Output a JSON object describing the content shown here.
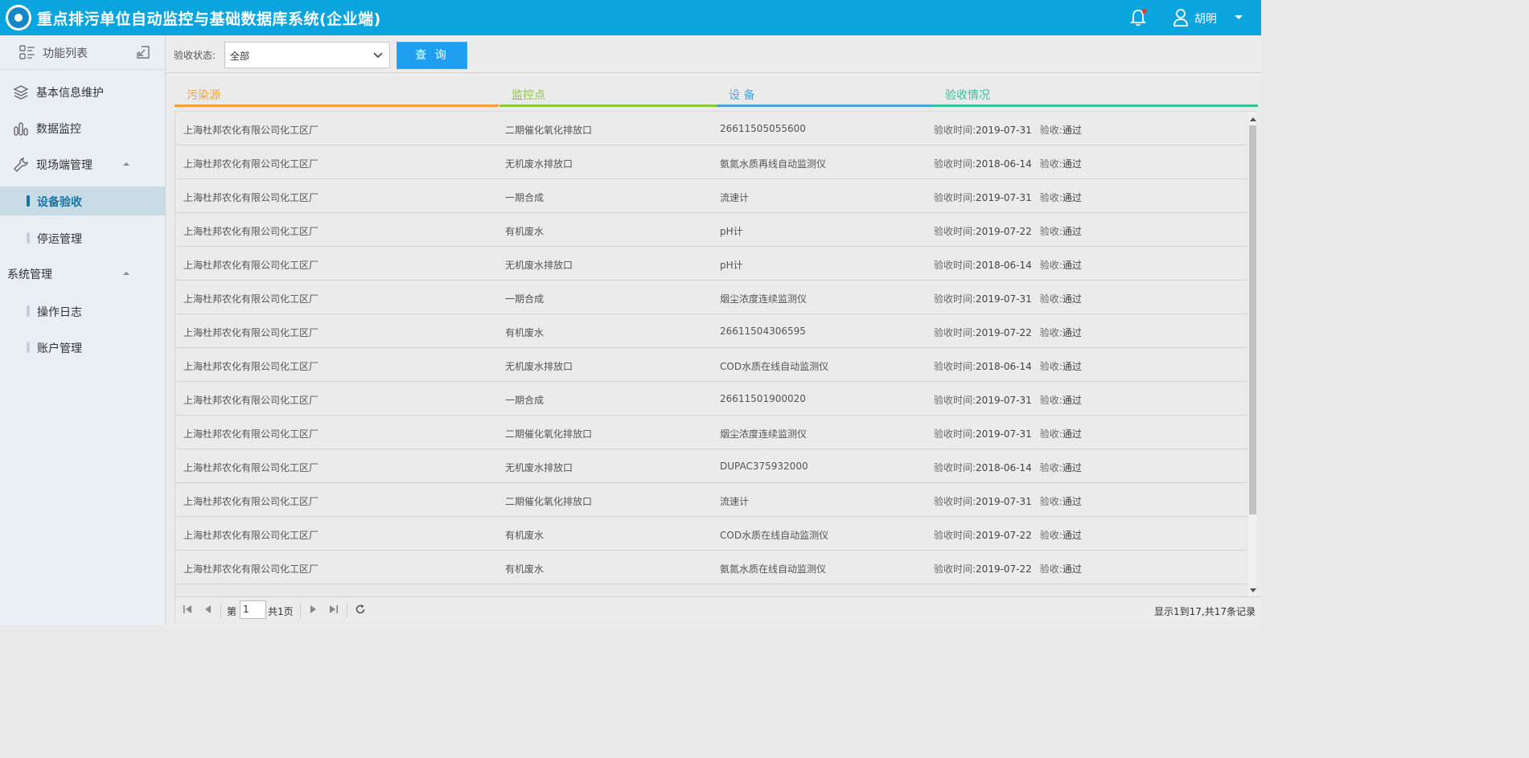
{
  "header": {
    "title": "重点排污单位自动监控与基础数据库系统(企业端)",
    "user_name": "胡明"
  },
  "sidebar": {
    "func_list_label": "功能列表",
    "items": [
      {
        "label": "基本信息维护",
        "icon": "layers-icon"
      },
      {
        "label": "数据监控",
        "icon": "bar-chart-icon"
      },
      {
        "label": "现场端管理",
        "icon": "wrench-icon"
      }
    ],
    "site_sub": [
      {
        "label": "设备验收",
        "active": true
      },
      {
        "label": "停运管理",
        "active": false
      }
    ],
    "system_group": "系统管理",
    "system_sub": [
      {
        "label": "操作日志"
      },
      {
        "label": "账户管理"
      }
    ]
  },
  "toolbar": {
    "filter_label": "验收状态:",
    "filter_value": "全部",
    "query_label": "查 询"
  },
  "columns": [
    {
      "label": "污染源",
      "color": "#f0a13a"
    },
    {
      "label": "监控点",
      "color": "#8cc63f"
    },
    {
      "label": "设 备",
      "color": "#4fa3d8"
    },
    {
      "label": "验收情况",
      "color": "#3bbf9a"
    }
  ],
  "rows": [
    {
      "source": "上海杜邦农化有限公司化工区厂",
      "point": "二期催化氧化排放口",
      "device": "26611505055600",
      "time_label": "验收时间:",
      "time": "2019-07-31",
      "status_label": "验收:",
      "status": "通过"
    },
    {
      "source": "上海杜邦农化有限公司化工区厂",
      "point": "无机废水排放口",
      "device": "氨氮水质再线自动监测仪",
      "time_label": "验收时间:",
      "time": "2018-06-14",
      "status_label": "验收:",
      "status": "通过"
    },
    {
      "source": "上海杜邦农化有限公司化工区厂",
      "point": "一期合成",
      "device": "流速计",
      "time_label": "验收时间:",
      "time": "2019-07-31",
      "status_label": "验收:",
      "status": "通过"
    },
    {
      "source": "上海杜邦农化有限公司化工区厂",
      "point": "有机废水",
      "device": "pH计",
      "time_label": "验收时间:",
      "time": "2019-07-22",
      "status_label": "验收:",
      "status": "通过"
    },
    {
      "source": "上海杜邦农化有限公司化工区厂",
      "point": "无机废水排放口",
      "device": "pH计",
      "time_label": "验收时间:",
      "time": "2018-06-14",
      "status_label": "验收:",
      "status": "通过"
    },
    {
      "source": "上海杜邦农化有限公司化工区厂",
      "point": "一期合成",
      "device": "烟尘浓度连续监测仪",
      "time_label": "验收时间:",
      "time": "2019-07-31",
      "status_label": "验收:",
      "status": "通过"
    },
    {
      "source": "上海杜邦农化有限公司化工区厂",
      "point": "有机废水",
      "device": "26611504306595",
      "time_label": "验收时间:",
      "time": "2019-07-22",
      "status_label": "验收:",
      "status": "通过"
    },
    {
      "source": "上海杜邦农化有限公司化工区厂",
      "point": "无机废水排放口",
      "device": "COD水质在线自动监测仪",
      "time_label": "验收时间:",
      "time": "2018-06-14",
      "status_label": "验收:",
      "status": "通过"
    },
    {
      "source": "上海杜邦农化有限公司化工区厂",
      "point": "一期合成",
      "device": "26611501900020",
      "time_label": "验收时间:",
      "time": "2019-07-31",
      "status_label": "验收:",
      "status": "通过"
    },
    {
      "source": "上海杜邦农化有限公司化工区厂",
      "point": "二期催化氧化排放口",
      "device": "烟尘浓度连续监测仪",
      "time_label": "验收时间:",
      "time": "2019-07-31",
      "status_label": "验收:",
      "status": "通过"
    },
    {
      "source": "上海杜邦农化有限公司化工区厂",
      "point": "无机废水排放口",
      "device": "DUPAC375932000",
      "time_label": "验收时间:",
      "time": "2018-06-14",
      "status_label": "验收:",
      "status": "通过"
    },
    {
      "source": "上海杜邦农化有限公司化工区厂",
      "point": "二期催化氧化排放口",
      "device": "流速计",
      "time_label": "验收时间:",
      "time": "2019-07-31",
      "status_label": "验收:",
      "status": "通过"
    },
    {
      "source": "上海杜邦农化有限公司化工区厂",
      "point": "有机废水",
      "device": "COD水质在线自动监测仪",
      "time_label": "验收时间:",
      "time": "2019-07-22",
      "status_label": "验收:",
      "status": "通过"
    },
    {
      "source": "上海杜邦农化有限公司化工区厂",
      "point": "有机废水",
      "device": "氨氮水质在线自动监测仪",
      "time_label": "验收时间:",
      "time": "2019-07-22",
      "status_label": "验收:",
      "status": "通过"
    }
  ],
  "pager": {
    "page_prefix": "第",
    "page_value": "1",
    "page_suffix": "共1页",
    "info": "显示1到17,共17条记录"
  }
}
